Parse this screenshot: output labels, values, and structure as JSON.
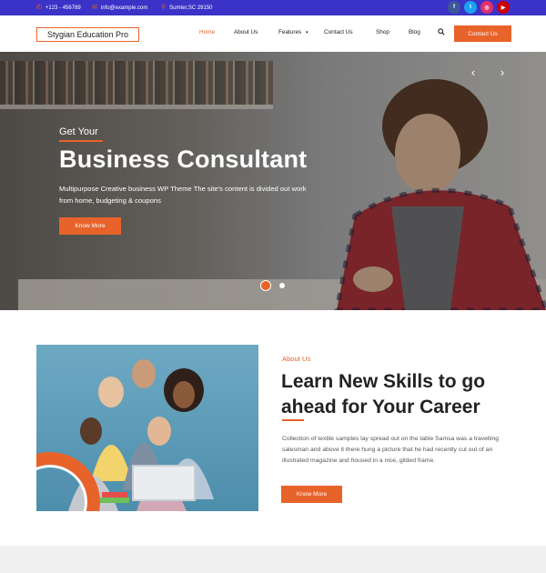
{
  "topbar": {
    "phone": "+123 - 456789",
    "email": "info@example.com",
    "address": "Sumter,SC 29150",
    "socials": [
      {
        "name": "facebook",
        "glyph": "f",
        "color": "#3b5998"
      },
      {
        "name": "twitter",
        "glyph": "t",
        "color": "#1da1f2"
      },
      {
        "name": "instagram",
        "glyph": "◎",
        "color": "#e1306c"
      },
      {
        "name": "youtube",
        "glyph": "▶",
        "color": "#cc0000"
      }
    ]
  },
  "header": {
    "logo": "Stygian Education Pro",
    "nav": [
      "Home",
      "About Us",
      "Features",
      "Contact Us",
      "Shop",
      "Blog"
    ],
    "active_nav": "Home",
    "contact_button": "Contact Us"
  },
  "hero": {
    "subtitle": "Get Your",
    "title": "Business Consultant",
    "description": "Multipurpose Creative business WP Theme The site's content is divided out work from home, budgeting & coupons",
    "button": "Know More",
    "prev_arrow": "‹",
    "next_arrow": "›",
    "slides": 2,
    "active_slide": 1
  },
  "about": {
    "label": "About Us",
    "title": "Learn New Skills to go ahead for Your Career",
    "description": "Collection of textile samples lay spread out on the table Samsa was a travelling salesman and above it there hung a picture that he had recently cut out of an illustrated magazine and housed in a nice, gilded frame.",
    "button": "Know More"
  },
  "colors": {
    "accent": "#e8632a",
    "topbar": "#3b33c7"
  }
}
